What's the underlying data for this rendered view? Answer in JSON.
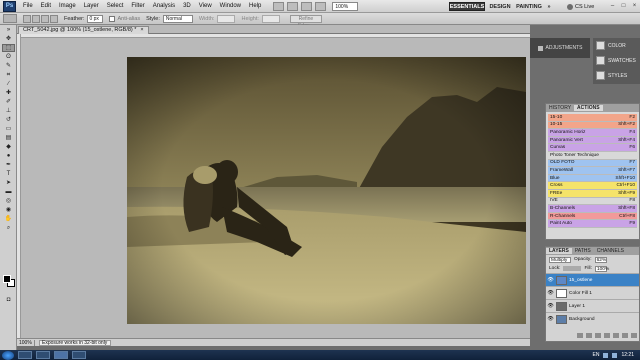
{
  "app": {
    "logo": "Ps",
    "menus": [
      "File",
      "Edit",
      "Image",
      "Layer",
      "Select",
      "Filter",
      "Analysis",
      "3D",
      "View",
      "Window",
      "Help"
    ],
    "zoom_box": "100%",
    "workspaces": {
      "essentials": "ESSENTIALS",
      "design": "DESIGN",
      "painting": "PAINTING",
      "more": "»"
    },
    "cs_live": "CS Live",
    "window_controls": {
      "minimize": "–",
      "maximize": "□",
      "close": "×"
    }
  },
  "options_bar": {
    "feather_label": "Feather:",
    "feather_value": "0 px",
    "antialias_label": "Anti-alias",
    "style_label": "Style:",
    "style_value": "Normal",
    "width_label": "Width:",
    "height_label": "Height:",
    "refine_label": "Refine Edge..."
  },
  "document": {
    "tab_title": "CRT_5042.jpg @ 100% (15_ostlene, RGB/8) *",
    "tab_close": "×"
  },
  "status": {
    "zoom": "100%",
    "message": "Exposure works in 32-bit only"
  },
  "right_dock": {
    "adjustments_label": "ADJUSTMENTS",
    "panels": [
      {
        "label": "COLOR",
        "icon": "color-icon"
      },
      {
        "label": "SWATCHES",
        "icon": "swatches-icon"
      },
      {
        "label": "STYLES",
        "icon": "styles-icon"
      }
    ]
  },
  "actions_panel": {
    "tabs": [
      "HISTORY",
      "ACTIONS"
    ],
    "rows": [
      {
        "name": "15-10",
        "key": "F2",
        "color": "#f2a58a"
      },
      {
        "name": "10-15",
        "key": "Shft+F2",
        "color": "#f2a58a"
      },
      {
        "name": "Panoramic Horiz",
        "key": "F4",
        "color": "#c9a3e6"
      },
      {
        "name": "Panoramic Vert",
        "key": "Shft+F4",
        "color": "#c9a3e6"
      },
      {
        "name": "Curvas",
        "key": "F6",
        "color": "#c9a3e6"
      },
      {
        "name": "Photo Toner Technique",
        "key": "",
        "color": "#d8d8d8"
      },
      {
        "name": "OLD FOTO",
        "key": "F7",
        "color": "#9fc3f0"
      },
      {
        "name": "FrameWall",
        "key": "Shft+F7",
        "color": "#9fc3f0"
      },
      {
        "name": "Blue",
        "key": "Shft+F10",
        "color": "#9fc3f0"
      },
      {
        "name": "Cross",
        "key": "Ctrl+F10",
        "color": "#f5e36a"
      },
      {
        "name": "FREe",
        "key": "Shft+F9",
        "color": "#f5e36a"
      },
      {
        "name": "IVE",
        "key": "F8",
        "color": "#d8d8d8"
      },
      {
        "name": "B-Channels",
        "key": "Shft+F8",
        "color": "#c9a3e6"
      },
      {
        "name": "R-Channels",
        "key": "Ctrl+F8",
        "color": "#f29a9a"
      },
      {
        "name": "Paint Auto",
        "key": "F9",
        "color": "#c9a3e6"
      }
    ]
  },
  "layers_panel": {
    "tabs": [
      "LAYERS",
      "PATHS",
      "CHANNELS"
    ],
    "blend_mode": "Multiply",
    "opacity_label": "Opacity:",
    "opacity_value": "62%",
    "lock_label": "Lock:",
    "fill_label": "Fill:",
    "fill_value": "100%",
    "layers": [
      {
        "name": "15_ostlene",
        "selected": true,
        "thumb": "#5e88c6"
      },
      {
        "name": "Color Fill 1",
        "selected": false,
        "thumb": "#ffffff"
      },
      {
        "name": "Layer 1",
        "selected": false,
        "thumb": "#6b6b6b"
      },
      {
        "name": "Background",
        "selected": false,
        "thumb": "#5d7ea8"
      }
    ]
  },
  "taskbar": {
    "lang": "EN",
    "time": "12:21"
  }
}
